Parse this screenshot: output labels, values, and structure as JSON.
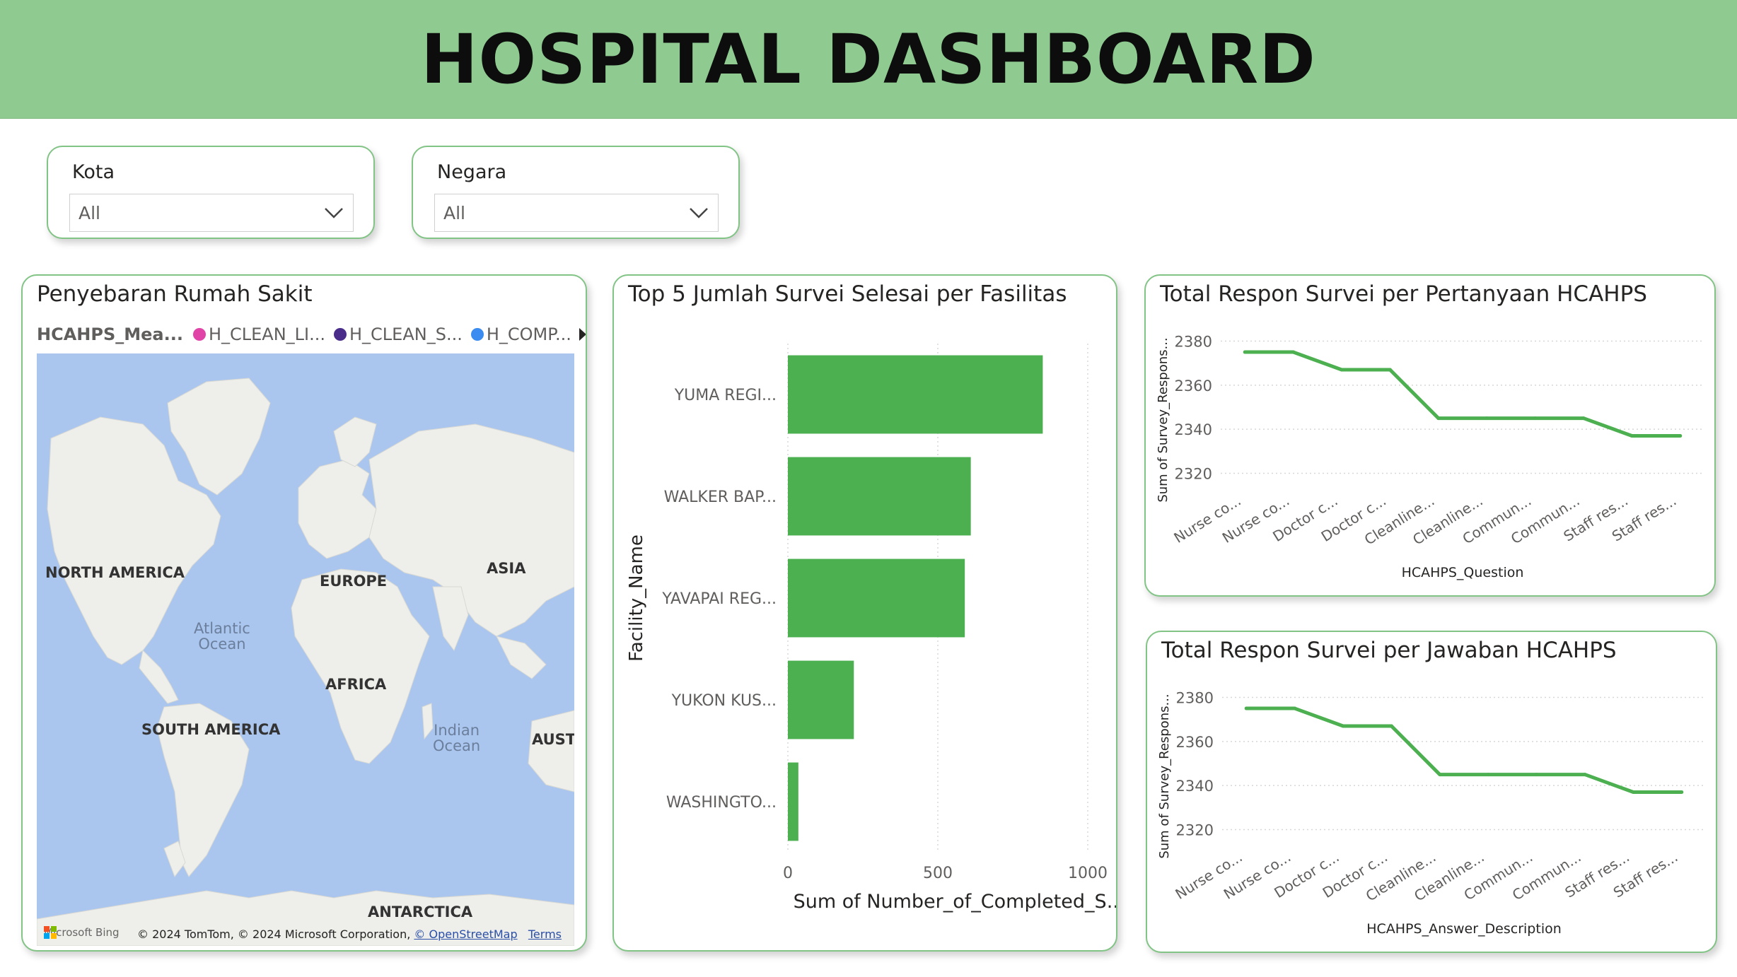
{
  "header": {
    "title": "HOSPITAL DASHBOARD"
  },
  "filters": {
    "kota": {
      "title": "Kota",
      "value": "All"
    },
    "negara": {
      "title": "Negara",
      "value": "All"
    }
  },
  "map_card": {
    "title": "Penyebaran Rumah Sakit",
    "legend_title": "HCAHPS_Mea...",
    "legend_items": [
      {
        "label": "H_CLEAN_LI...",
        "color": "#e044a7"
      },
      {
        "label": "H_CLEAN_S...",
        "color": "#4a2c8a"
      },
      {
        "label": "H_COMP...",
        "color": "#3a8cf0"
      }
    ],
    "continents": {
      "north_america": "NORTH AMERICA",
      "europe": "EUROPE",
      "asia": "ASIA",
      "africa": "AFRICA",
      "south_america": "SOUTH AMERICA",
      "australia": "AUSTI",
      "antarctica": "ANTARCTICA"
    },
    "oceans": {
      "atlantic": "Atlantic\nOcean",
      "indian": "Indian\nOcean"
    },
    "footer": {
      "bing": "Microsoft Bing",
      "copyright": "© 2024 TomTom, © 2024 Microsoft Corporation,",
      "osm": "© OpenStreetMap",
      "terms": "Terms"
    },
    "colors": {
      "ocean": "#aac6ee",
      "land": "#eeeeea"
    }
  },
  "bar_card": {
    "title": "Top 5 Jumlah Survei Selesai per Fasilitas",
    "chart_data": {
      "type": "bar",
      "orientation": "horizontal",
      "categories": [
        "YUMA REGI...",
        "WALKER BAP...",
        "YAVAPAI REG...",
        "YUKON KUS...",
        "WASHINGTO..."
      ],
      "values": [
        850,
        610,
        590,
        220,
        35
      ],
      "xlabel": "Sum of Number_of_Completed_S...",
      "ylabel": "Facility_Name",
      "xlim": [
        0,
        1000
      ],
      "xticks": [
        0,
        500,
        1000
      ],
      "color": "#4caf50",
      "grid": true
    }
  },
  "line_card_1": {
    "title": "Total Respon Survei per Pertanyaan HCAHPS",
    "chart_data": {
      "type": "line",
      "categories": [
        "Nurse co...",
        "Nurse co...",
        "Doctor c...",
        "Doctor c...",
        "Cleanline...",
        "Cleanline...",
        "Commun...",
        "Commun...",
        "Staff res...",
        "Staff res..."
      ],
      "values": [
        2375,
        2375,
        2367,
        2367,
        2345,
        2345,
        2345,
        2345,
        2337,
        2337
      ],
      "xlabel": "HCAHPS_Question",
      "ylabel": "Sum of Survey_Respons...",
      "ylim": [
        2316,
        2384
      ],
      "yticks": [
        2320,
        2340,
        2360,
        2380
      ],
      "color": "#4caf50",
      "grid": true
    }
  },
  "line_card_2": {
    "title": "Total Respon Survei per Jawaban HCAHPS",
    "chart_data": {
      "type": "line",
      "categories": [
        "Nurse co...",
        "Nurse co...",
        "Doctor c...",
        "Doctor c...",
        "Cleanline...",
        "Cleanline...",
        "Commun...",
        "Commun...",
        "Staff res...",
        "Staff res..."
      ],
      "values": [
        2375,
        2375,
        2367,
        2367,
        2345,
        2345,
        2345,
        2345,
        2337,
        2337
      ],
      "xlabel": "HCAHPS_Answer_Description",
      "ylabel": "Sum of Survey_Respons...",
      "ylim": [
        2316,
        2384
      ],
      "yticks": [
        2320,
        2340,
        2360,
        2380
      ],
      "color": "#4caf50",
      "grid": true
    }
  }
}
